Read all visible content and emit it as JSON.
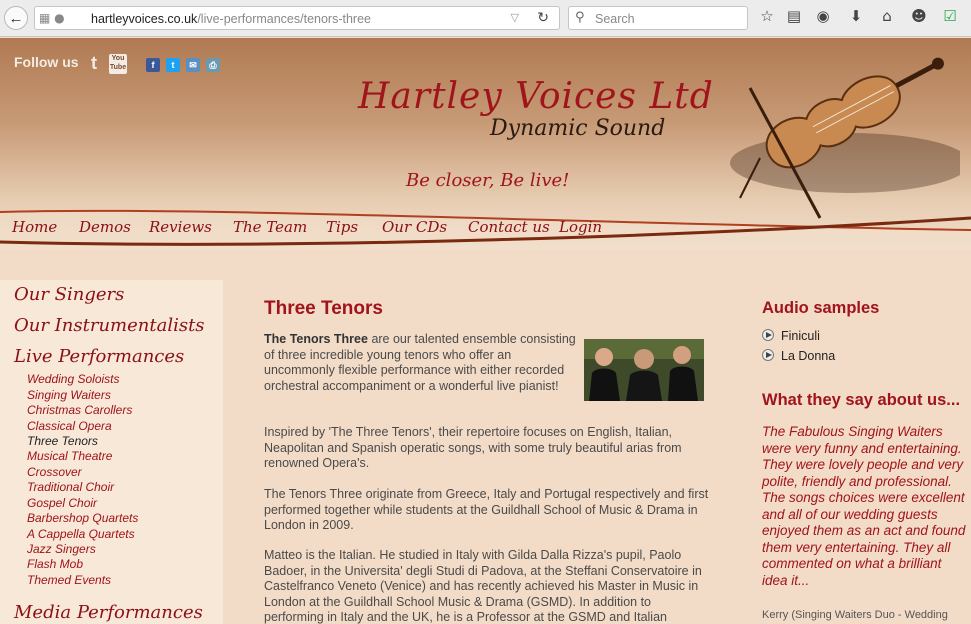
{
  "browser": {
    "url_domain": "hartleyvoices.co.uk",
    "url_path": "/live-performances/tenors-three",
    "search_placeholder": "Search"
  },
  "colors": {
    "accent": "#a0141b",
    "background": "#f3dcc7",
    "sidebar_bg": "#f8e8d8"
  },
  "header": {
    "follow_us": "Follow us",
    "social_icons": [
      "twitter-icon",
      "youtube-icon",
      "facebook-icon",
      "twitter-icon",
      "email-icon",
      "print-icon"
    ],
    "youtube_label": "You Tube",
    "logo_title": "Hartley Voices Ltd",
    "logo_subtitle": "Dynamic Sound",
    "tagline": "Be closer, Be live!"
  },
  "nav": [
    "Home",
    "Demos",
    "Reviews",
    "The Team",
    "Tips",
    "Our CDs",
    "Contact us",
    "Login"
  ],
  "sidebar": {
    "headings": [
      "Our Singers",
      "Our Instrumentalists",
      "Live Performances",
      "Media Performances"
    ],
    "items": [
      "Wedding Soloists",
      "Singing Waiters",
      "Christmas Carollers",
      "Classical Opera",
      "Three Tenors",
      "Musical Theatre",
      "Crossover",
      "Traditional Choir",
      "Gospel Choir",
      "Barbershop Quartets",
      "A Cappella Quartets",
      "Jazz Singers",
      "Flash Mob",
      "Themed Events"
    ]
  },
  "main": {
    "title": "Three Tenors",
    "p1_bold": "The Tenors Three",
    "p1_rest": " are our talented ensemble consisting of three incredible young tenors who offer an uncommonly flexible performance with either recorded orchestral accompaniment or a wonderful live pianist!",
    "p2": "Inspired by 'The Three Tenors', their repertoire focuses on English, Italian, Neapolitan and Spanish operatic songs, with some truly beautiful arias from renowned Opera's.",
    "p3": "The Tenors Three originate from Greece, Italy and Portugal respectively and first performed together while students at the Guildhall School of Music & Drama in London in 2009.",
    "p4": "Matteo is the Italian.  He studied in Italy with Gilda Dalla Rizza's pupil, Paolo Badoer, in the Universita' degli Studi di Padova, at the Steffani Conservatoire in Castelfranco Veneto (Venice) and has recently achieved his Master in Music in London at the Guildhall School Music & Drama (GSMD).  In addition to performing in Italy and the UK, he is a Professor at the GSMD and Italian"
  },
  "right": {
    "audio_title": "Audio samples",
    "audio_items": [
      "Finiculi",
      "La Donna"
    ],
    "testimonial_title": "What they say about us...",
    "quote": "The Fabulous Singing Waiters were very funny and entertaining. They were lovely people and very polite, friendly and professional. The songs choices were excellent and all of our wedding guests enjoyed them as an act and found them very entertaining. They all commented on what a brilliant idea it...",
    "quote_author": "Kerry (Singing Waiters Duo - Wedding"
  }
}
